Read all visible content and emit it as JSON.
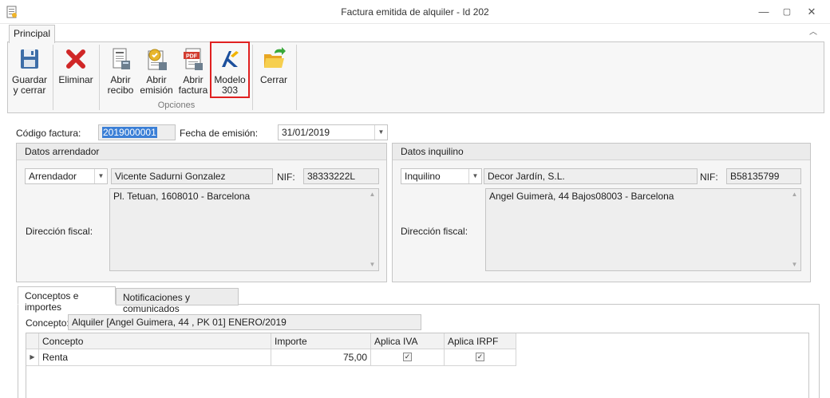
{
  "window": {
    "title": "Factura emitida de alquiler - Id 202",
    "controls": {
      "minimize": "—",
      "restore": "▢",
      "close": "✕"
    }
  },
  "ribbon": {
    "tab": "Principal",
    "buttons": {
      "save": "Guardar\ny cerrar",
      "delete": "Eliminar",
      "open_receipt": "Abrir\nrecibo",
      "open_issue": "Abrir\nemisión",
      "open_invoice": "Abrir\nfactura",
      "model_303": "Modelo\n303",
      "close": "Cerrar"
    },
    "group_label": "Opciones",
    "pdf_badge": "PDF"
  },
  "form": {
    "invoice_code_label": "Código factura:",
    "invoice_code": "2019000001",
    "issue_date_label": "Fecha de emisión:",
    "issue_date": "31/01/2019"
  },
  "landlord": {
    "header": "Datos arrendador",
    "role": "Arrendador",
    "name": "Vicente Sadurni Gonzalez",
    "nif_label": "NIF:",
    "nif": "38333222L",
    "address_label": "Dirección fiscal:",
    "address": "Pl. Tetuan, 1608010 - Barcelona"
  },
  "tenant": {
    "header": "Datos inquilino",
    "role": "Inquilino",
    "name": "Decor Jardín, S.L.",
    "nif_label": "NIF:",
    "nif": "B58135799",
    "address_label": "Dirección fiscal:",
    "address": "Angel Guimerà, 44 Bajos08003 - Barcelona"
  },
  "tabs": [
    "Conceptos e importes",
    "Notificaciones y comunicados"
  ],
  "concept": {
    "label": "Concepto:",
    "value": "Alquiler [Angel Guimera, 44 , PK 01] ENERO/2019"
  },
  "grid": {
    "columns": [
      "Concepto",
      "Importe",
      "Aplica IVA",
      "Aplica IRPF"
    ],
    "rows": [
      {
        "concepto": "Renta",
        "importe": "75,00",
        "aplica_iva": true,
        "aplica_irpf": true
      }
    ]
  }
}
